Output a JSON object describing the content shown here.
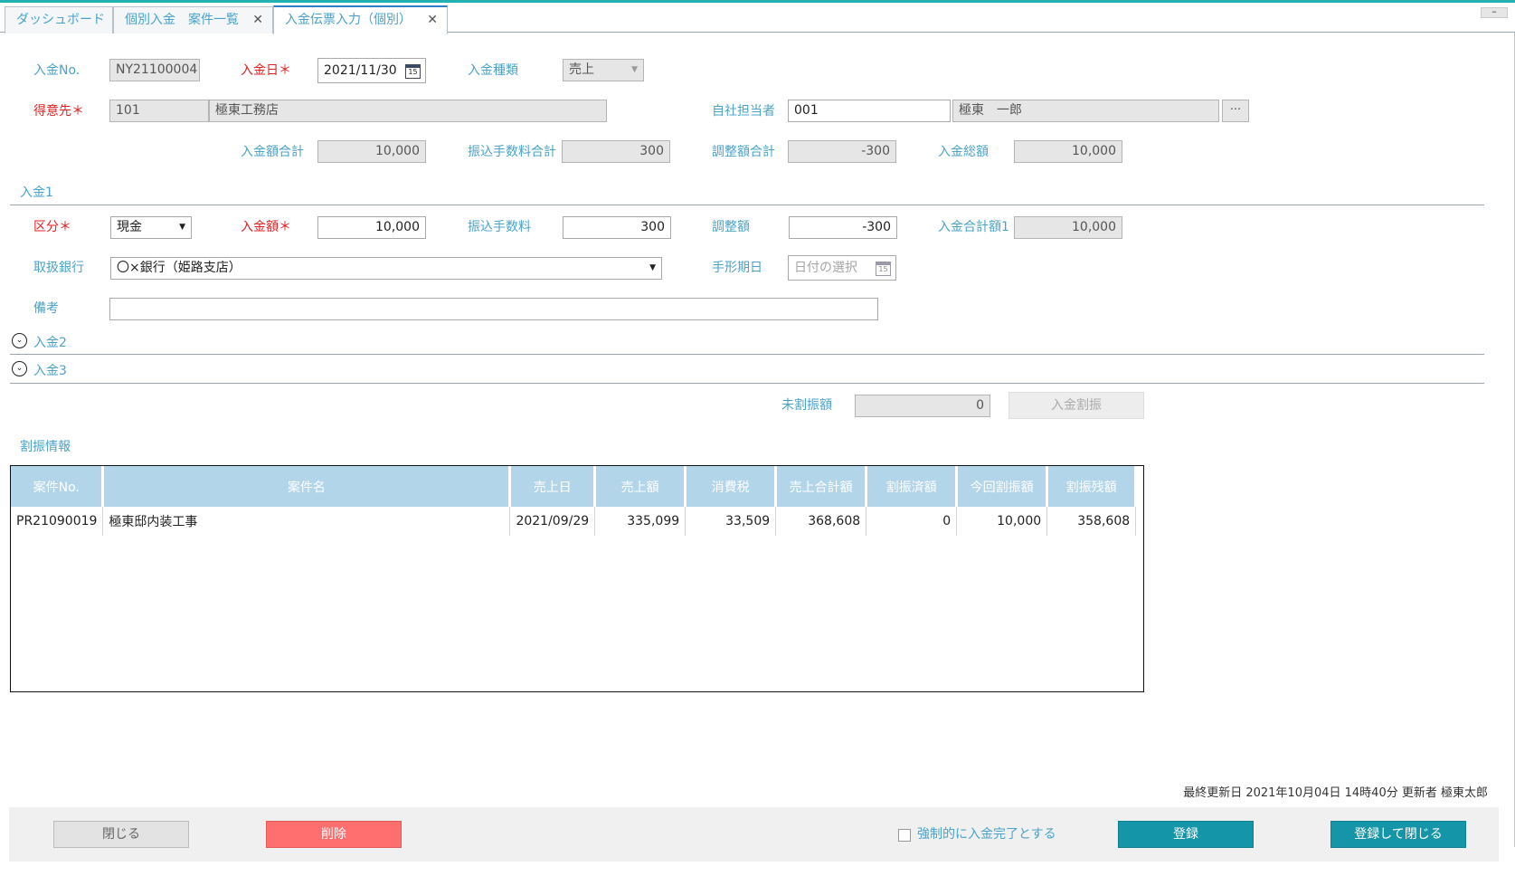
{
  "tabs": [
    {
      "label": "ダッシュボード"
    },
    {
      "label": "個別入金　案件一覧",
      "close": "✕"
    },
    {
      "label": "入金伝票入力（個別）",
      "close": "✕"
    }
  ],
  "window": {
    "minimize": "–"
  },
  "header": {
    "payment_no_label": "入金No.",
    "payment_no_value": "NY21100004",
    "payment_date_label": "入金日＊",
    "payment_date_value": "2021/11/30",
    "payment_type_label": "入金種類",
    "payment_type_value": "売上",
    "customer_label": "得意先＊",
    "customer_code": "101",
    "customer_name": "極東工務店",
    "staff_label": "自社担当者",
    "staff_code": "001",
    "staff_name": "極東　一郎",
    "staff_lookup": "···"
  },
  "totals": {
    "amount_total_label": "入金額合計",
    "amount_total_value": "10,000",
    "fee_total_label": "振込手数料合計",
    "fee_total_value": "300",
    "adjust_total_label": "調整額合計",
    "adjust_total_value": "-300",
    "grand_total_label": "入金総額",
    "grand_total_value": "10,000"
  },
  "payment1": {
    "title": "入金1",
    "kind_label": "区分＊",
    "kind_value": "現金",
    "amount_label": "入金額＊",
    "amount_value": "10,000",
    "fee_label": "振込手数料",
    "fee_value": "300",
    "adjust_label": "調整額",
    "adjust_value": "-300",
    "subtotal_label": "入金合計額1",
    "subtotal_value": "10,000",
    "bank_label": "取扱銀行",
    "bank_value": "〇×銀行（姫路支店）",
    "bill_date_label": "手形期日",
    "bill_date_placeholder": "日付の選択",
    "memo_label": "備考",
    "memo_value": ""
  },
  "collapsed": [
    {
      "title": "入金2"
    },
    {
      "title": "入金3"
    }
  ],
  "allocation": {
    "unallocated_label": "未割振額",
    "unallocated_value": "0",
    "allocate_button": "入金割振",
    "section_title": "割振情報",
    "columns": [
      "案件No.",
      "案件名",
      "売上日",
      "売上額",
      "消費税",
      "売上合計額",
      "割振済額",
      "今回割振額",
      "割振残額"
    ],
    "rows": [
      [
        "PR21090019",
        "極東邸内装工事",
        "2021/09/29",
        "335,099",
        "33,509",
        "368,608",
        "0",
        "10,000",
        "358,608"
      ]
    ]
  },
  "footer": {
    "updated_text": "最終更新日 2021年10月04日 14時40分 更新者 極東太郎",
    "close_button": "閉じる",
    "delete_button": "削除",
    "force_complete_label": "強制的に入金完了とする",
    "force_complete_checked": false,
    "register_button": "登録",
    "register_close_button": "登録して閉じる"
  },
  "colors": {
    "accent": "#4aa3c8",
    "required": "#e02020",
    "primary_button": "#1596a8",
    "danger_button": "#ff6f6f",
    "grid_header": "#b3d5ea"
  }
}
